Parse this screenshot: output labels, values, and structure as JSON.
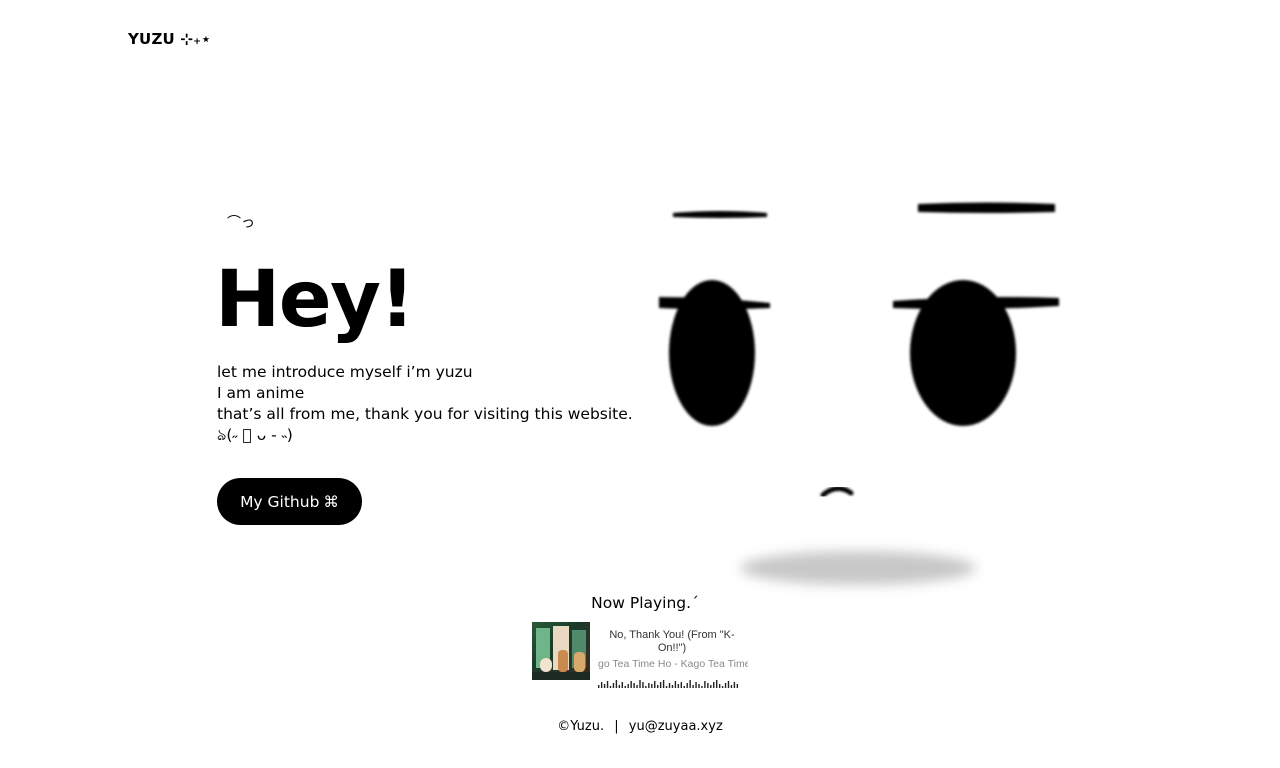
{
  "header": {
    "logo": "YUZU ⊹₊⋆"
  },
  "hero": {
    "kaomoji_top": "⌒⁠っ",
    "title": "Hey!",
    "intro_lines": [
      "let me introduce myself i’m yuzu",
      "I am anime",
      "that’s all from me, thank you for visiting this website.",
      "ঌ(˶ ॑ ᴗ - ˵)"
    ],
    "github_button": {
      "label": "My Github",
      "icon": "⌘"
    }
  },
  "now_playing": {
    "heading": "Now Playing.´",
    "track_title": "No, Thank You! (From \"K-On!!\")",
    "track_artist_scrolling": "go Tea Time     Ho - Kago Tea Time",
    "album_art_icon": "k-on-album-cover"
  },
  "footer": {
    "copyright": "©Yuzu.",
    "separator": "|",
    "email": "yu@zuyaa.xyz"
  },
  "colors": {
    "background": "#ffffff",
    "text": "#000000",
    "button_bg": "#000000",
    "button_text": "#ffffff",
    "muted_text": "#8a8a8a"
  }
}
